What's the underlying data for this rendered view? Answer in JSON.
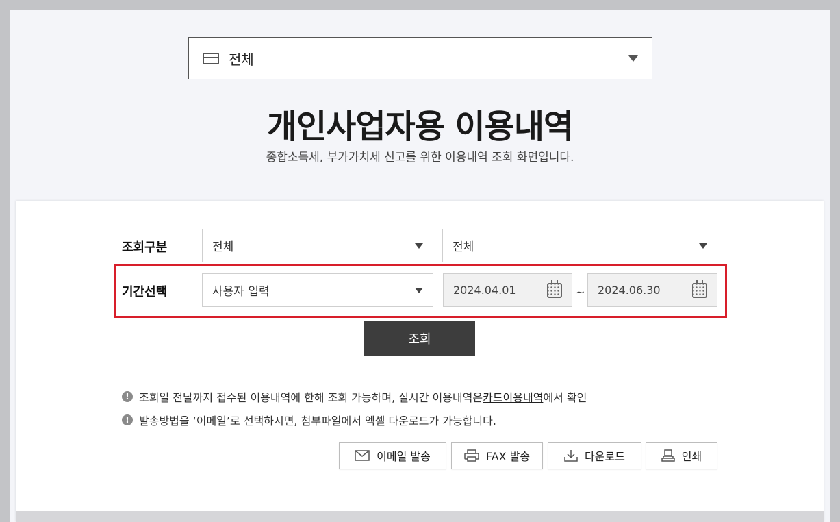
{
  "card_selector": {
    "value": "전체",
    "icon": "credit-card-icon"
  },
  "header": {
    "title": "개인사업자용 이용내역",
    "subtitle": "종합소득세, 부가가치세 신고를 위한 이용내역 조회 화면입니다."
  },
  "form": {
    "category": {
      "label": "조회구분",
      "select1": "전체",
      "select2": "전체"
    },
    "period": {
      "label": "기간선택",
      "mode": "사용자 입력",
      "start_date": "2024.04.01",
      "separator": "~",
      "end_date": "2024.06.30"
    },
    "search_label": "조회"
  },
  "notices": {
    "line1_before": "조회일 전날까지 접수된 이용내역에 한해 조회 가능하며, 실시간 이용내역은 ",
    "line1_link": "카드이용내역",
    "line1_after": "에서 확인",
    "line2": "발송방법을 ‘이메일’로 선택하시면, 첨부파일에서 엑셀 다운로드가 가능합니다."
  },
  "actions": {
    "email": "이메일 발송",
    "fax": "FAX 발송",
    "download": "다운로드",
    "print": "인쇄"
  },
  "colors": {
    "highlight": "#d81e2a",
    "search_button": "#3d3d3d",
    "page_background": "#f4f5f9"
  }
}
